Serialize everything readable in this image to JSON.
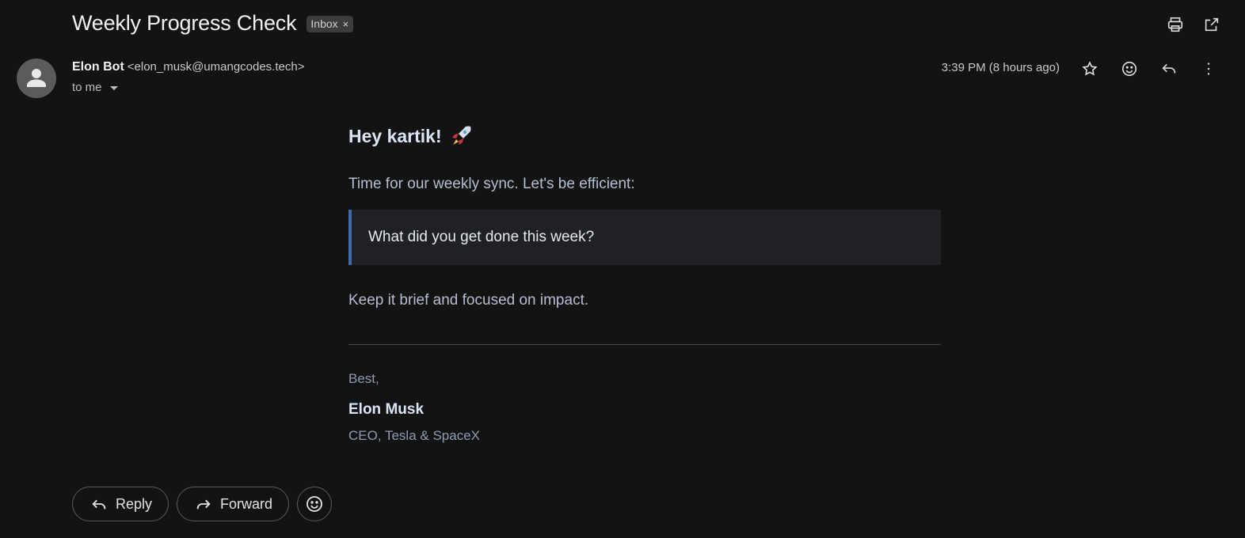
{
  "email": {
    "subject": "Weekly Progress Check",
    "label": "Inbox",
    "label_close": "×",
    "sender_name": "Elon Bot",
    "sender_email": "<elon_musk@umangcodes.tech>",
    "to": "to me",
    "timestamp": "3:39 PM (8 hours ago)"
  },
  "body": {
    "greeting": "Hey kartik!",
    "intro": "Time for our weekly sync. Let's be efficient:",
    "quote": "What did you get done this week?",
    "outro": "Keep it brief and focused on impact.",
    "signoff": "Best,",
    "signature_name": "Elon Musk",
    "signature_title": "CEO, Tesla & SpaceX"
  },
  "actions": {
    "reply": "Reply",
    "forward": "Forward"
  },
  "icons": {
    "print": "print-icon",
    "open_new_window": "open-in-new-window-icon",
    "star": "star-icon",
    "emoji": "emoji-icon",
    "reply": "reply-icon",
    "more": "more-vert-icon",
    "forward": "forward-icon",
    "rocket": "rocket-icon"
  },
  "colors": {
    "background": "#131313",
    "quote_bar": "#3f6ab0",
    "quote_bg": "#1f2124"
  }
}
